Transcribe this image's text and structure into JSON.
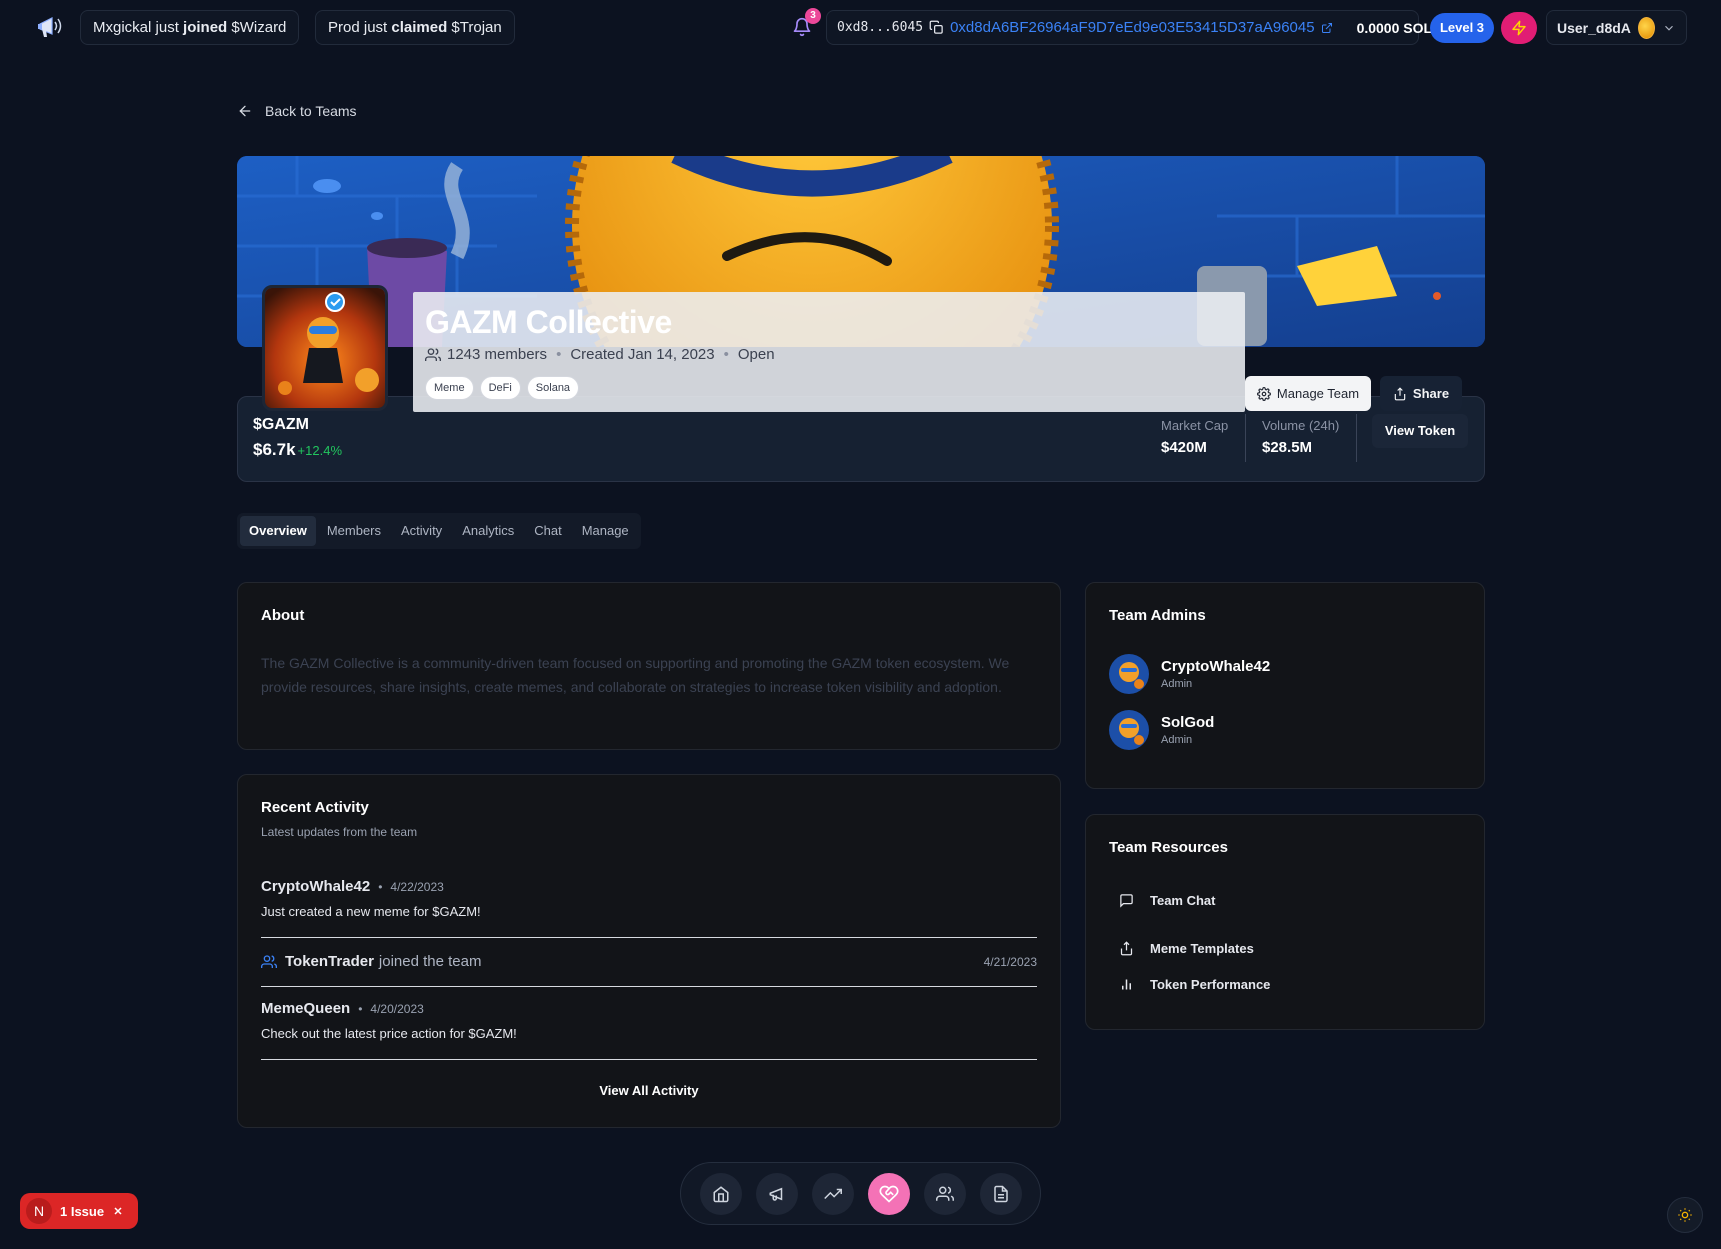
{
  "topbar": {
    "ticker1": {
      "user": "Mxgickal",
      "mid": "just",
      "action": "joined",
      "token": "$Wizard"
    },
    "ticker2": {
      "user": "Prod",
      "mid": "just",
      "action": "claimed",
      "token": "$Trojan"
    },
    "notifications_count": "3",
    "wallet_short": "0xd8...6045",
    "wallet_full": "0xd8dA6BF26964aF9D7eEd9e03E53415D37aA96045",
    "balance": "0.0000 SOL",
    "level": "Level 3",
    "username": "User_d8dA"
  },
  "back_label": "Back to Teams",
  "team": {
    "name": "GAZM Collective",
    "members": "1243 members",
    "created": "Created Jan 14, 2023",
    "status": "Open",
    "tags": [
      "Meme",
      "DeFi",
      "Solana"
    ],
    "manage_label": "Manage Team",
    "share_label": "Share"
  },
  "token": {
    "symbol": "$GAZM",
    "price": "$6.7k",
    "change": "+12.4%",
    "market_cap_label": "Market Cap",
    "market_cap": "$420M",
    "volume_label": "Volume (24h)",
    "volume": "$28.5M",
    "view_label": "View Token"
  },
  "tabs": [
    "Overview",
    "Members",
    "Activity",
    "Analytics",
    "Chat",
    "Manage"
  ],
  "about": {
    "title": "About",
    "text": "The GAZM Collective is a community-driven team focused on supporting and promoting the GAZM token ecosystem. We provide resources, share insights, create memes, and collaborate on strategies to increase token visibility and adoption."
  },
  "activity": {
    "title": "Recent Activity",
    "subtitle": "Latest updates from the team",
    "items": [
      {
        "user": "CryptoWhale42",
        "date": "4/22/2023",
        "message": "Just created a new meme for $GAZM!"
      },
      {
        "user": "TokenTrader",
        "action": "joined the team",
        "date": "4/21/2023"
      },
      {
        "user": "MemeQueen",
        "date": "4/20/2023",
        "message": "Check out the latest price action for $GAZM!"
      }
    ],
    "view_all": "View All Activity"
  },
  "admins": {
    "title": "Team Admins",
    "items": [
      {
        "name": "CryptoWhale42",
        "role": "Admin"
      },
      {
        "name": "SolGod",
        "role": "Admin"
      }
    ]
  },
  "resources": {
    "title": "Team Resources",
    "items": [
      {
        "label": "Team Chat",
        "icon": "message-icon"
      },
      {
        "label": "Meme Templates",
        "icon": "upload-icon"
      },
      {
        "label": "Token Performance",
        "icon": "bar-chart-icon"
      }
    ]
  },
  "dock": [
    "home-icon",
    "megaphone-icon",
    "trending-icon",
    "heart-handshake-icon",
    "users-icon",
    "document-icon"
  ],
  "issue": {
    "badge": "N",
    "label": "1 Issue"
  },
  "colors": {
    "accent_blue": "#2563eb",
    "accent_pink": "#ec4899",
    "positive": "#22c55e",
    "background": "#0c1220"
  }
}
